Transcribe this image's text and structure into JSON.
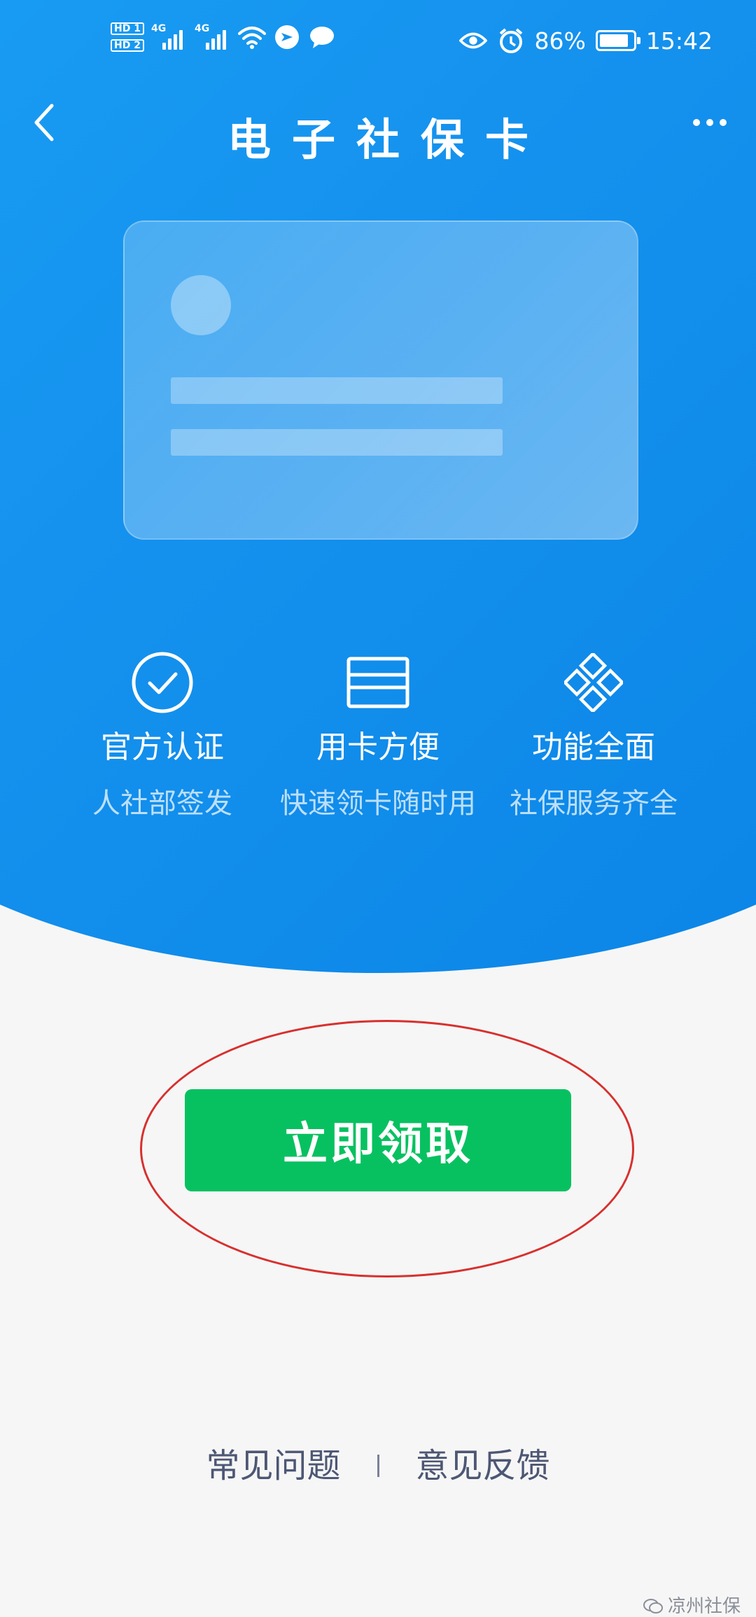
{
  "status_bar": {
    "sim1": "HD 1",
    "sim2": "HD 2",
    "network": "4G",
    "battery_percent": "86%",
    "battery_level": 0.86,
    "time": "15:42"
  },
  "header": {
    "title": "电子社保卡"
  },
  "features": [
    {
      "title": "官方认证",
      "subtitle": "人社部签发",
      "icon": "check-circle-icon"
    },
    {
      "title": "用卡方便",
      "subtitle": "快速领卡随时用",
      "icon": "card-icon"
    },
    {
      "title": "功能全面",
      "subtitle": "社保服务齐全",
      "icon": "diamond-grid-icon"
    }
  ],
  "claim_button": {
    "label": "立即领取"
  },
  "footer": {
    "faq": "常见问题",
    "feedback": "意见反馈"
  },
  "watermark": {
    "label": "凉州社保"
  },
  "colors": {
    "hero_blue": "#1592ee",
    "button_green": "#07c160",
    "annotation_red": "#d8302e",
    "footer_text": "#4d5774"
  }
}
